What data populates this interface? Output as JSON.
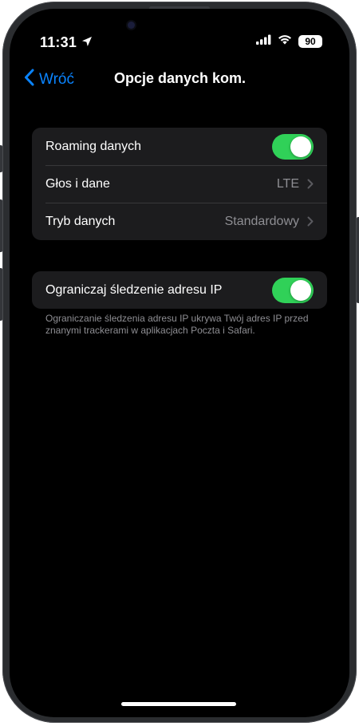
{
  "status_bar": {
    "time": "11:31",
    "battery": "90",
    "location_icon": "location-arrow-icon",
    "signal_icon": "cellular-signal-icon",
    "wifi_icon": "wifi-icon"
  },
  "nav": {
    "back_label": "Wróć",
    "title": "Opcje danych kom."
  },
  "group1": {
    "rows": [
      {
        "label": "Roaming danych",
        "toggle": true
      },
      {
        "label": "Głos i dane",
        "value": "LTE"
      },
      {
        "label": "Tryb danych",
        "value": "Standardowy"
      }
    ]
  },
  "group2": {
    "rows": [
      {
        "label": "Ograniczaj śledzenie adresu IP",
        "toggle": true
      }
    ],
    "footnote": "Ograniczanie śledzenia adresu IP ukrywa Twój adres IP przed znanymi trackerami w aplikacjach Poczta i Safari."
  },
  "colors": {
    "accent": "#0a84ff",
    "toggle_on": "#30d158",
    "cell_bg": "#1c1c1e",
    "secondary_text": "#8e8e93"
  }
}
